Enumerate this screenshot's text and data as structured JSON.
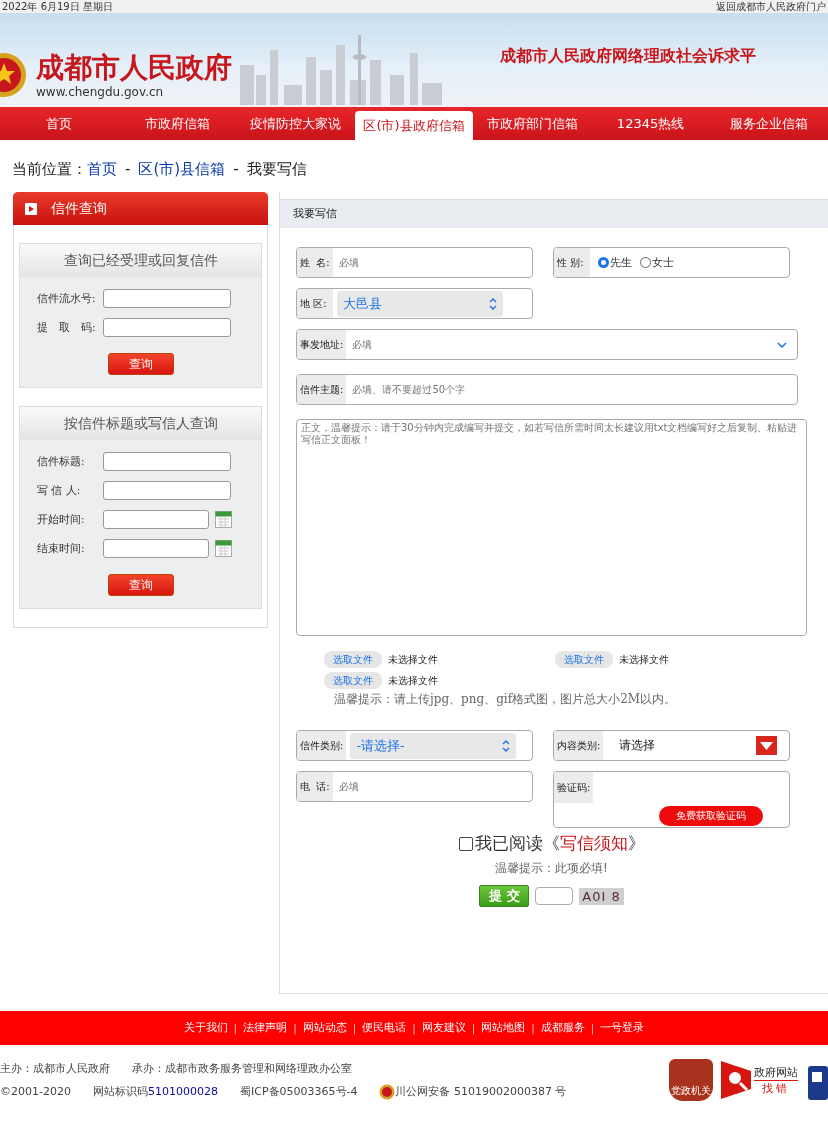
{
  "top_bar": {
    "date": "2022年 6月19日 星期日",
    "portal_link": "返回成都市人民政府门户"
  },
  "banner": {
    "site_name": "成都市人民政府",
    "url": "www.chengdu.gov.cn",
    "platform_title": "成都市人民政府网络理政社会诉求平"
  },
  "nav": [
    {
      "label": "首页",
      "selected": false
    },
    {
      "label": "市政府信箱",
      "selected": false
    },
    {
      "label": "疫情防控大家说",
      "selected": false
    },
    {
      "label": "区(市)县政府信箱",
      "selected": true
    },
    {
      "label": "市政府部门信箱",
      "selected": false
    },
    {
      "label": "12345热线",
      "selected": false
    },
    {
      "label": "服务企业信箱",
      "selected": false
    }
  ],
  "breadcrumb": {
    "prefix": "当前位置：",
    "items": [
      {
        "label": "首页",
        "kind": "link"
      },
      {
        "label": "区(市)县信箱",
        "kind": "link"
      },
      {
        "label": "我要写信",
        "kind": "current"
      }
    ],
    "separator": "-"
  },
  "sidebar": {
    "title": "信件查询",
    "sections": [
      {
        "title": "查询已经受理或回复信件",
        "fields": [
          {
            "label": "信件流水号:",
            "calendar": false
          },
          {
            "label": "提　取　码:",
            "calendar": false
          }
        ],
        "button": "查询"
      },
      {
        "title": "按信件标题或写信人查询",
        "fields": [
          {
            "label": "信件标题:",
            "calendar": false
          },
          {
            "label": "写 信 人:",
            "calendar": false
          },
          {
            "label": "开始时间:",
            "calendar": true
          },
          {
            "label": "结束时间:",
            "calendar": true
          }
        ],
        "button": "查询"
      }
    ]
  },
  "form": {
    "title": "我要写信",
    "rows": [
      [
        {
          "kind": "text",
          "label": "姓  名:",
          "placeholder": "必填"
        },
        {
          "kind": "radio",
          "label": "性 别:",
          "options": [
            {
              "label": "先生",
              "selected": true
            },
            {
              "label": "女士",
              "selected": false
            }
          ]
        }
      ],
      [
        {
          "kind": "select",
          "label": "地 区:",
          "value": "大邑县"
        }
      ],
      [
        {
          "kind": "dropdown",
          "label": "事发地址:",
          "placeholder": "必填"
        }
      ],
      [
        {
          "kind": "text-wide",
          "label": "信件主题:",
          "placeholder": "必填、请不要超过50个字"
        }
      ]
    ],
    "body": {
      "placeholder": "正文，温馨提示：请于30分钟内完成编写并提交，如若写信所需时间太长建议用txt文档编写好之后复制、粘贴进写信正文面板！"
    },
    "uploads": [
      {
        "button": "选取文件",
        "status": "未选择文件"
      },
      {
        "button": "选取文件",
        "status": "未选择文件"
      },
      {
        "button": "选取文件",
        "status": "未选择文件"
      }
    ],
    "upload_hint": "温馨提示：请上传jpg、png、gif格式图，图片总大小2M以内。",
    "rows2": [
      [
        {
          "kind": "select",
          "label": "信件类别:",
          "value": "-请选择-"
        },
        {
          "kind": "red-select",
          "label": "内容类别:",
          "value": "请选择"
        }
      ],
      [
        {
          "kind": "text",
          "label": "电  话:",
          "placeholder": "必填"
        },
        {
          "kind": "captcha",
          "label": "验证码:",
          "button": "免费获取验证码"
        }
      ]
    ],
    "agreement": {
      "checked": false,
      "before": "我已阅读《",
      "link": "写信须知",
      "after": "》"
    },
    "required_hint": "温馨提示：此项必填!",
    "submit": "提 交",
    "captcha_code": "A0I 8"
  },
  "footer": {
    "separator": "|",
    "links": [
      "关于我们",
      "法律声明",
      "网站动态",
      "便民电话",
      "网友建议",
      "网站地图",
      "成都服务",
      "一号登录"
    ],
    "host": "主办：成都市人民政府",
    "organizer": "承办：成都市政务服务管理和网络理政办公室",
    "copyright": "©2001-2020",
    "site_code_label": "网站标识码",
    "site_code": "5101000028",
    "icp": "蜀ICP备05003365号-4",
    "police": "川公网安备 51019002000387 号",
    "badge_text": "党政机关",
    "error_title": "政府网站",
    "error_action": "找错"
  }
}
